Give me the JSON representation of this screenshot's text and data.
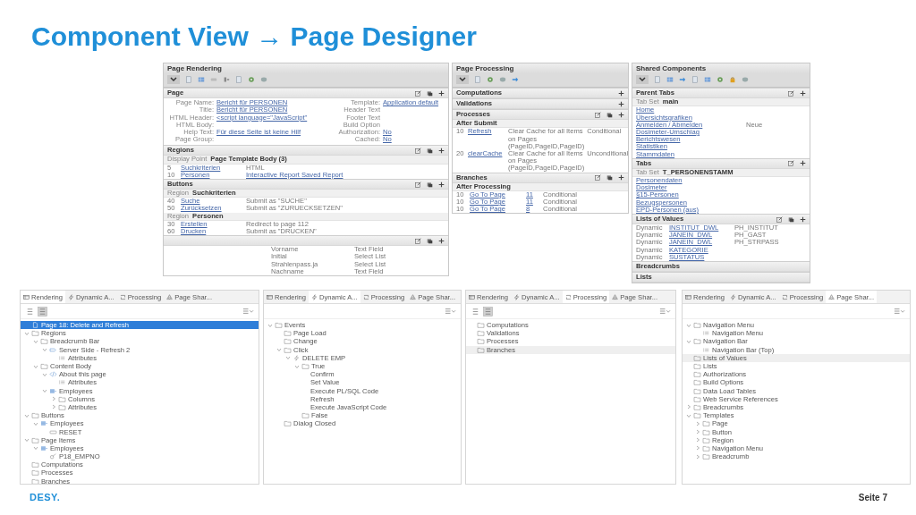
{
  "title": "Component View → Page Designer",
  "page_rendering": {
    "title": "Page Rendering",
    "sections": [
      {
        "title": "Page",
        "can_edit": true,
        "can_copy": true,
        "can_add": true,
        "blocks": [
          {
            "kind": "props",
            "columns": [
              [
                {
                  "label": "Page Name:",
                  "value": "Bericht für PERSONEN",
                  "link": true
                },
                {
                  "label": "Title:",
                  "value": "Bericht für PERSONEN",
                  "link": true
                },
                {
                  "label": "HTML Header:",
                  "value": "<script language=\"JavaScript\"",
                  "link": true
                },
                {
                  "label": "HTML Body:"
                },
                {
                  "label": "Help Text:",
                  "value": "Für diese Seite ist keine Hilf",
                  "link": true
                },
                {
                  "label": "Page Group:"
                }
              ],
              [
                {
                  "label": "Template:",
                  "value": "Application default",
                  "link": true
                },
                {
                  "label": "Header Text"
                },
                {
                  "label": "Footer Text"
                },
                {
                  "label": "Build Option"
                },
                {
                  "label": "Authorization:",
                  "value": "No",
                  "link": true
                },
                {
                  "label": "Cached:",
                  "value": "No",
                  "link": true
                }
              ]
            ]
          }
        ]
      },
      {
        "title": "Regions",
        "can_edit": true,
        "can_copy": true,
        "can_add": true,
        "blocks": [
          {
            "kind": "group",
            "label": "Display Point",
            "value": "Page Template Body (3)"
          },
          {
            "kind": "rows",
            "rows": [
              {
                "cells": [
                  {
                    "text": "5",
                    "link": false
                  },
                  {
                    "text": "Suchkriterien",
                    "link": true
                  },
                  {
                    "text": "HTML",
                    "link": false
                  }
                ]
              },
              {
                "cells": [
                  {
                    "text": "10",
                    "link": false
                  },
                  {
                    "text": "Personen",
                    "link": true
                  },
                  {
                    "text": "Interactive Report Saved Report",
                    "link": true
                  }
                ]
              }
            ]
          }
        ]
      },
      {
        "title": "Buttons",
        "can_edit": true,
        "can_copy": true,
        "can_add": true,
        "blocks": [
          {
            "kind": "group",
            "label": "Region",
            "value": "Suchkriterien"
          },
          {
            "kind": "rows",
            "rows": [
              {
                "cells": [
                  {
                    "text": "40",
                    "link": false
                  },
                  {
                    "text": "Suche",
                    "link": true
                  },
                  {
                    "text": "Submit as \"SUCHE\"",
                    "link": false
                  }
                ]
              },
              {
                "cells": [
                  {
                    "text": "50",
                    "link": false
                  },
                  {
                    "text": "Zurücksetzen",
                    "link": true
                  },
                  {
                    "text": "Submit as \"ZURUECKSETZEN\"",
                    "link": false
                  }
                ]
              }
            ]
          },
          {
            "kind": "group",
            "label": "Region",
            "value": "Personen"
          },
          {
            "kind": "rows",
            "rows": [
              {
                "cells": [
                  {
                    "text": "30",
                    "link": false
                  },
                  {
                    "text": "Erstellen",
                    "link": true
                  },
                  {
                    "text": "Redirect to page 112",
                    "link": false
                  }
                ]
              },
              {
                "cells": [
                  {
                    "text": "60",
                    "link": false
                  },
                  {
                    "text": "Drucken",
                    "link": true
                  },
                  {
                    "text": "Submit as \"DRUCKEN\"",
                    "link": false
                  }
                ]
              }
            ]
          }
        ]
      },
      {
        "can_edit": true,
        "can_copy": true,
        "can_add": true,
        "blocks": [
          {
            "kind": "rows",
            "rows": [
              {
                "cells": [
                  {
                    "text": "Vorname",
                    "link": false
                  },
                  {
                    "text": "Text Field",
                    "link": false
                  }
                ]
              },
              {
                "cells": [
                  {
                    "text": "Initial",
                    "link": false
                  },
                  {
                    "text": "Select List",
                    "link": false
                  }
                ]
              },
              {
                "cells": [
                  {
                    "text": "Strahlenpass.ja",
                    "link": false
                  },
                  {
                    "text": "Select List",
                    "link": false
                  }
                ]
              },
              {
                "cells": [
                  {
                    "text": "Nachname",
                    "link": false
                  },
                  {
                    "text": "Text Field",
                    "link": false
                  }
                ]
              }
            ]
          }
        ]
      }
    ]
  },
  "page_processing": {
    "title": "Page Processing",
    "sections": [
      {
        "title": "Computations",
        "can_add": true
      },
      {
        "title": "Validations",
        "can_add": true
      },
      {
        "title": "Processes",
        "can_edit": true,
        "can_copy": true,
        "can_add": true,
        "blocks": [
          {
            "kind": "group",
            "value": "After Submit"
          },
          {
            "kind": "rows",
            "rows": [
              {
                "cells": [
                  {
                    "text": "10",
                    "link": false
                  },
                  {
                    "text": "Refresh",
                    "link": true
                  },
                  {
                    "text": "Clear Cache for all Items on Pages (PageID,PageID,PageID)",
                    "link": false
                  },
                  {
                    "text": "Conditional",
                    "link": false
                  }
                ]
              },
              {
                "cells": [
                  {
                    "text": "20",
                    "link": false
                  },
                  {
                    "text": "clearCache",
                    "link": true
                  },
                  {
                    "text": "Clear Cache for all Items on Pages (PageID,PageID,PageID)",
                    "link": false
                  },
                  {
                    "text": "Unconditional",
                    "link": false
                  }
                ]
              }
            ]
          }
        ]
      },
      {
        "title": "Branches",
        "can_edit": true,
        "can_copy": true,
        "can_add": true,
        "blocks": [
          {
            "kind": "group",
            "value": "After Processing"
          },
          {
            "kind": "rows",
            "rows": [
              {
                "cells": [
                  {
                    "text": "10",
                    "link": false
                  },
                  {
                    "text": "Go To Page",
                    "link": true
                  },
                  {
                    "text": "11",
                    "link": true
                  },
                  {
                    "text": "Conditional",
                    "link": false
                  }
                ]
              },
              {
                "cells": [
                  {
                    "text": "10",
                    "link": false
                  },
                  {
                    "text": "Go To Page",
                    "link": true
                  },
                  {
                    "text": "11",
                    "link": true
                  },
                  {
                    "text": "Conditional",
                    "link": false
                  }
                ]
              },
              {
                "cells": [
                  {
                    "text": "10",
                    "link": false
                  },
                  {
                    "text": "Go To Page",
                    "link": true
                  },
                  {
                    "text": "8",
                    "link": true
                  },
                  {
                    "text": "Conditional",
                    "link": false
                  }
                ]
              }
            ]
          }
        ]
      }
    ]
  },
  "shared_components": {
    "title": "Shared Components",
    "sections": [
      {
        "title": "Parent Tabs",
        "can_edit": true,
        "can_add": true,
        "blocks": [
          {
            "kind": "group",
            "label": "Tab Set",
            "value": "main"
          },
          {
            "kind": "rows",
            "rows": [
              {
                "cells": [
                  {
                    "text": "Home",
                    "link": true
                  }
                ]
              },
              {
                "cells": [
                  {
                    "text": "Übersichtsgrafiken",
                    "link": true
                  }
                ]
              },
              {
                "cells": [
                  {
                    "text": "Anmelden / Abmelden",
                    "link": true
                  },
                  {
                    "text": "Neue",
                    "link": false
                  }
                ]
              },
              {
                "cells": [
                  {
                    "text": "Dosimeter-Umschlag",
                    "link": true
                  }
                ]
              },
              {
                "cells": [
                  {
                    "text": "Berichtswesen",
                    "link": true
                  }
                ]
              },
              {
                "cells": [
                  {
                    "text": "Statistiken",
                    "link": true
                  }
                ]
              },
              {
                "cells": [
                  {
                    "text": "Stammdaten",
                    "link": true
                  }
                ]
              }
            ]
          }
        ]
      },
      {
        "title": "Tabs",
        "can_edit": true,
        "can_add": true,
        "blocks": [
          {
            "kind": "group",
            "label": "Tab Set",
            "value": "T_PERSONENSTAMM"
          },
          {
            "kind": "rows",
            "rows": [
              {
                "cells": [
                  {
                    "text": "Personendaten",
                    "link": true
                  }
                ]
              },
              {
                "cells": [
                  {
                    "text": "Dosimeter",
                    "link": true
                  }
                ]
              },
              {
                "cells": [
                  {
                    "text": "§15-Personen",
                    "link": true
                  }
                ]
              },
              {
                "cells": [
                  {
                    "text": "Bezugspersonen",
                    "link": true
                  }
                ]
              },
              {
                "cells": [
                  {
                    "text": "EPD-Personen (aus)",
                    "link": true
                  }
                ]
              }
            ]
          }
        ]
      },
      {
        "title": "Lists of Values",
        "can_edit": true,
        "can_copy": true,
        "can_add": true,
        "blocks": [
          {
            "kind": "rows",
            "rows": [
              {
                "cells": [
                  {
                    "text": "Dynamic",
                    "link": false
                  },
                  {
                    "text": "INSTITUT_DWL",
                    "link": true
                  },
                  {
                    "text": "PH_INSTITUT",
                    "link": false
                  }
                ]
              },
              {
                "cells": [
                  {
                    "text": "Dynamic",
                    "link": false
                  },
                  {
                    "text": "JANEIN_DWL",
                    "link": true
                  },
                  {
                    "text": "PH_GAST",
                    "link": false
                  }
                ]
              },
              {
                "cells": [
                  {
                    "text": "Dynamic",
                    "link": false
                  },
                  {
                    "text": "JANEIN_DWL",
                    "link": true
                  },
                  {
                    "text": "PH_STRPASS",
                    "link": false
                  }
                ]
              },
              {
                "cells": [
                  {
                    "text": "Dynamic",
                    "link": false
                  },
                  {
                    "text": "KATEGORIE",
                    "link": true
                  }
                ]
              },
              {
                "cells": [
                  {
                    "text": "Dynamic",
                    "link": false
                  },
                  {
                    "text": "SUSTATUS",
                    "link": true
                  }
                ]
              }
            ]
          }
        ]
      },
      {
        "title": "Breadcrumbs"
      },
      {
        "title": "Lists"
      }
    ]
  },
  "rendering_tree": {
    "focused": true,
    "tabs": [
      {
        "label": "Rendering",
        "selected": true
      },
      {
        "label": "Dynamic A...",
        "selected": false
      },
      {
        "label": "Processing",
        "selected": false
      },
      {
        "label": "Page Shar...",
        "selected": false
      }
    ],
    "view_buttons": [
      {
        "selected": false
      },
      {
        "selected": true
      }
    ],
    "nodes": [
      {
        "label": "Page 18: Delete and Refresh",
        "kind": "page",
        "selected": true
      },
      {
        "label": "Regions",
        "kind": "folder",
        "selected": false,
        "expanded": true,
        "children": [
          {
            "label": "Breadcrumb Bar",
            "kind": "folder",
            "selected": false,
            "expanded": true,
            "children": [
              {
                "label": "Server Side - Refresh 2",
                "kind": "breadcrumb",
                "selected": false,
                "expanded": true,
                "children": [
                  {
                    "label": "Attributes",
                    "kind": "list",
                    "selected": false
                  }
                ]
              }
            ]
          },
          {
            "label": "Content Body",
            "kind": "folder",
            "selected": false,
            "expanded": true,
            "children": [
              {
                "label": "About this page",
                "kind": "code",
                "selected": false,
                "expanded": true,
                "children": [
                  {
                    "label": "Attributes",
                    "kind": "list",
                    "selected": false
                  }
                ]
              },
              {
                "label": "Employees",
                "kind": "grid",
                "selected": false,
                "expanded": true,
                "children": [
                  {
                    "label": "Columns",
                    "kind": "folder",
                    "selected": false,
                    "expanded": false
                  },
                  {
                    "label": "Attributes",
                    "kind": "folder",
                    "selected": false,
                    "expanded": false
                  }
                ]
              }
            ]
          }
        ]
      },
      {
        "label": "Buttons",
        "kind": "folder",
        "selected": false,
        "expanded": true,
        "children": [
          {
            "label": "Employees",
            "kind": "grid",
            "selected": false,
            "expanded": true,
            "children": [
              {
                "label": "RESET",
                "kind": "button",
                "selected": false
              }
            ]
          }
        ]
      },
      {
        "label": "Page Items",
        "kind": "folder",
        "selected": false,
        "expanded": true,
        "children": [
          {
            "label": "Employees",
            "kind": "grid",
            "selected": false,
            "expanded": true,
            "children": [
              {
                "label": "P18_EMPNO",
                "kind": "item",
                "selected": false
              }
            ]
          }
        ]
      },
      {
        "label": "Computations",
        "kind": "folder",
        "selected": false
      },
      {
        "label": "Processes",
        "kind": "folder",
        "selected": false
      },
      {
        "label": "Branches",
        "kind": "folder",
        "selected": false
      }
    ]
  },
  "dynamic_actions_tree": {
    "tabs": [
      {
        "label": "Rendering",
        "selected": false
      },
      {
        "label": "Dynamic A...",
        "selected": true
      },
      {
        "label": "Processing",
        "selected": false
      },
      {
        "label": "Page Shar...",
        "selected": false
      }
    ],
    "nodes": [
      {
        "label": "Events",
        "kind": "folder",
        "selected": false,
        "expanded": true,
        "children": [
          {
            "label": "Page Load",
            "kind": "folder",
            "selected": false
          },
          {
            "label": "Change",
            "kind": "folder",
            "selected": false
          },
          {
            "label": "Click",
            "kind": "folder",
            "selected": false,
            "expanded": true,
            "children": [
              {
                "label": "DELETE EMP",
                "kind": "action",
                "selected": false,
                "expanded": true,
                "children": [
                  {
                    "label": "True",
                    "kind": "folder",
                    "selected": false,
                    "expanded": true,
                    "children": [
                      {
                        "label": "Confirm",
                        "selected": false
                      },
                      {
                        "label": "Set Value",
                        "selected": false
                      },
                      {
                        "label": "Execute PL/SQL Code",
                        "selected": false
                      },
                      {
                        "label": "Refresh",
                        "selected": false
                      },
                      {
                        "label": "Execute JavaScript Code",
                        "selected": false
                      }
                    ]
                  },
                  {
                    "label": "False",
                    "kind": "folder",
                    "selected": false
                  }
                ]
              }
            ]
          },
          {
            "label": "Dialog Closed",
            "kind": "folder",
            "selected": false
          }
        ]
      }
    ]
  },
  "processing_tree": {
    "focused": false,
    "tabs": [
      {
        "label": "Rendering",
        "selected": false
      },
      {
        "label": "Dynamic A...",
        "selected": false
      },
      {
        "label": "Processing",
        "selected": true
      },
      {
        "label": "Page Shar...",
        "selected": false
      }
    ],
    "view_buttons": [
      {
        "selected": false
      },
      {
        "selected": true
      }
    ],
    "nodes": [
      {
        "label": "Computations",
        "kind": "folder",
        "selected": false
      },
      {
        "label": "Validations",
        "kind": "folder",
        "selected": false
      },
      {
        "label": "Processes",
        "kind": "folder",
        "selected": false
      },
      {
        "label": "Branches",
        "kind": "folder",
        "selected": true
      }
    ]
  },
  "shared_components_tree": {
    "focused": false,
    "tabs": [
      {
        "label": "Rendering",
        "selected": false
      },
      {
        "label": "Dynamic A...",
        "selected": false
      },
      {
        "label": "Processing",
        "selected": false
      },
      {
        "label": "Page Shar...",
        "selected": true
      }
    ],
    "nodes": [
      {
        "label": "Navigation Menu",
        "kind": "folder",
        "selected": false,
        "expanded": true,
        "children": [
          {
            "label": "Navigation Menu",
            "kind": "list",
            "selected": false
          }
        ]
      },
      {
        "label": "Navigation Bar",
        "kind": "folder",
        "selected": false,
        "expanded": true,
        "children": [
          {
            "label": "Navigation Bar (Top)",
            "kind": "list",
            "selected": false
          }
        ]
      },
      {
        "label": "Lists of Values",
        "kind": "folder",
        "selected": true
      },
      {
        "label": "Lists",
        "kind": "folder",
        "selected": false
      },
      {
        "label": "Authorizations",
        "kind": "folder",
        "selected": false
      },
      {
        "label": "Build Options",
        "kind": "folder",
        "selected": false
      },
      {
        "label": "Data Load Tables",
        "kind": "folder",
        "selected": false
      },
      {
        "label": "Web Service References",
        "kind": "folder",
        "selected": false
      },
      {
        "label": "Breadcrumbs",
        "kind": "folder",
        "selected": false,
        "expanded": false
      },
      {
        "label": "Templates",
        "kind": "folder",
        "selected": false,
        "expanded": true,
        "children": [
          {
            "label": "Page",
            "kind": "folder",
            "selected": false,
            "expanded": false
          },
          {
            "label": "Button",
            "kind": "folder",
            "selected": false,
            "expanded": false
          },
          {
            "label": "Region",
            "kind": "folder",
            "selected": false,
            "expanded": false
          },
          {
            "label": "Navigation Menu",
            "kind": "folder",
            "selected": false,
            "expanded": false
          },
          {
            "label": "Breadcrumb",
            "kind": "folder",
            "selected": false,
            "expanded": false
          }
        ]
      }
    ]
  },
  "logo": "DESY.",
  "page_number": "Seite 7"
}
